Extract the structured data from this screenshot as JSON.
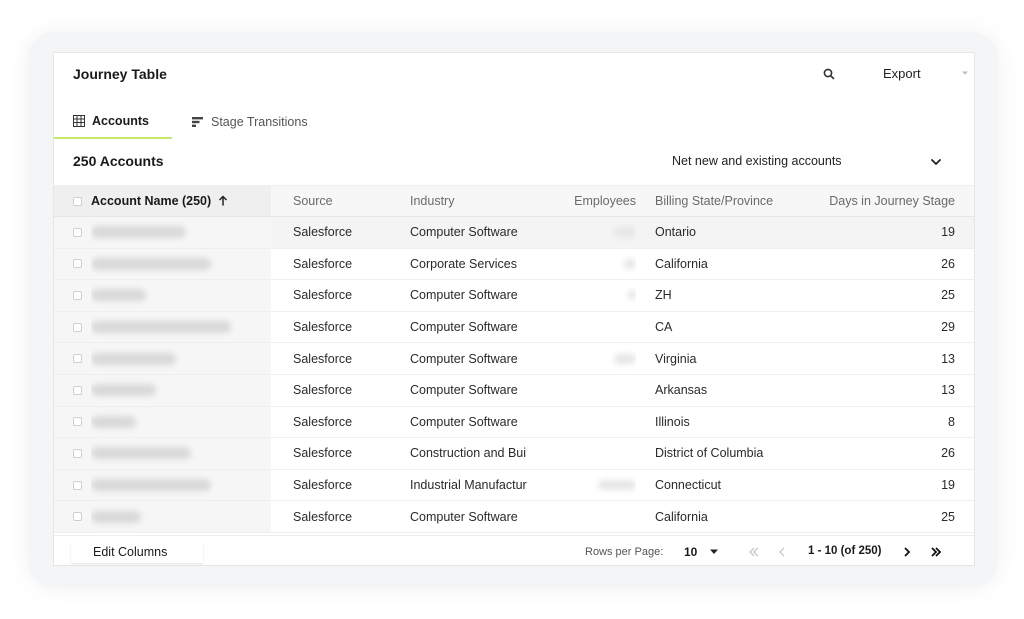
{
  "header": {
    "title": "Journey Table",
    "export_label": "Export"
  },
  "tabs": [
    {
      "label": "Accounts",
      "active": true,
      "icon": "grid-icon"
    },
    {
      "label": "Stage Transitions",
      "active": false,
      "icon": "bars-icon"
    }
  ],
  "summary": {
    "count_label": "250 Accounts",
    "filter_value": "Net new and existing accounts"
  },
  "table": {
    "columns": [
      "Account Name (250)",
      "Source",
      "Industry",
      "Employees",
      "Billing State/Province",
      "Days in Journey Stage"
    ],
    "rows": [
      {
        "source": "Salesforce",
        "industry": "Computer Software",
        "state": "Ontario",
        "days": "19"
      },
      {
        "source": "Salesforce",
        "industry": "Corporate Services",
        "state": "California",
        "days": "26"
      },
      {
        "source": "Salesforce",
        "industry": "Computer Software",
        "state": "ZH",
        "days": "25"
      },
      {
        "source": "Salesforce",
        "industry": "Computer Software",
        "state": "CA",
        "days": "29"
      },
      {
        "source": "Salesforce",
        "industry": "Computer Software",
        "state": "Virginia",
        "days": "13"
      },
      {
        "source": "Salesforce",
        "industry": "Computer Software",
        "state": "Arkansas",
        "days": "13"
      },
      {
        "source": "Salesforce",
        "industry": "Computer Software",
        "state": "Illinois",
        "days": "8"
      },
      {
        "source": "Salesforce",
        "industry": "Construction and Bui",
        "state": "District of Columbia",
        "days": "26"
      },
      {
        "source": "Salesforce",
        "industry": "Industrial Manufactur",
        "state": "Connecticut",
        "days": "19"
      },
      {
        "source": "Salesforce",
        "industry": "Computer Software",
        "state": "California",
        "days": "25"
      }
    ]
  },
  "footer": {
    "edit_columns_label": "Edit Columns",
    "rows_per_page_label": "Rows per Page:",
    "rows_per_page_value": "10",
    "range_label": "1 - 10 (of 250)"
  },
  "colors": {
    "accent": "#c9e86a"
  }
}
